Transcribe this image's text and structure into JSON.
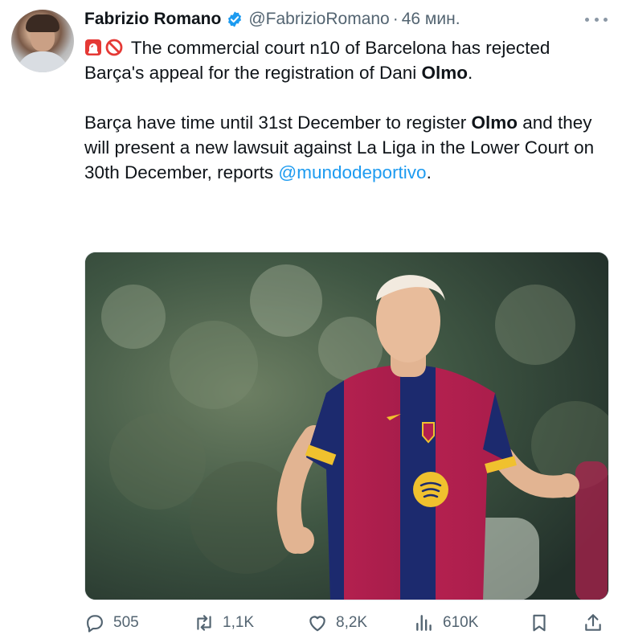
{
  "author": {
    "name": "Fabrizio Romano",
    "handle": "@FabrizioRomano",
    "separator": "·",
    "time": "46 мин."
  },
  "tweet": {
    "line1_text": " The commercial court n10 of Barcelona has rejected Barça's appeal for the registration of Dani ",
    "line1_bold": "Olmo",
    "line1_end": ".",
    "p2_text1": "Barça have time until 31st December to register ",
    "p2_bold": "Olmo",
    "p2_text2": " and they will present a new lawsuit against La Liga in the Lower Court on 30th December, reports ",
    "p2_mention": "@mundodeportivo",
    "p2_end": "."
  },
  "media": {
    "alt": "Dani Olmo in Barcelona kit"
  },
  "actions": {
    "replies": "505",
    "reposts": "1,1K",
    "likes": "8,2K",
    "views": "610K"
  },
  "icons": {
    "verified": "verified-badge-icon",
    "siren": "siren-emoji-icon",
    "prohibited": "no-entry-emoji-icon",
    "more": "more-dots-icon",
    "reply": "reply-icon",
    "repost": "repost-icon",
    "like": "heart-icon",
    "views": "views-chart-icon",
    "bookmark": "bookmark-icon",
    "share": "share-icon"
  },
  "colors": {
    "accent": "#1d9bf0",
    "text": "#0f1419",
    "muted": "#536471"
  }
}
